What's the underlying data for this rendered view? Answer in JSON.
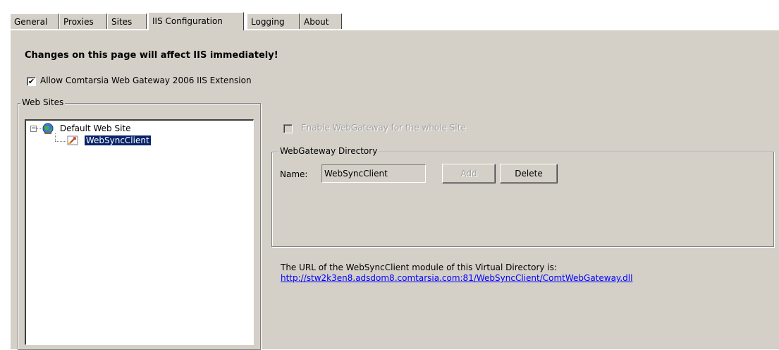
{
  "tabs": [
    {
      "label": "General"
    },
    {
      "label": "Proxies"
    },
    {
      "label": "Sites"
    },
    {
      "label": "IIS Configuration",
      "active": true
    },
    {
      "label": "Logging"
    },
    {
      "label": "About"
    }
  ],
  "page": {
    "warning": "Changes on this page will affect IIS immediately!",
    "allow_extension": {
      "label": "Allow Comtarsia Web Gateway 2006 IIS Extension",
      "checked": true
    }
  },
  "web_sites": {
    "legend": "Web Sites",
    "tree": {
      "root": {
        "label": "Default Web Site",
        "expanded": true,
        "icon": "globe-icon"
      },
      "child": {
        "label": "WebSyncClient",
        "selected": true,
        "icon": "virtual-directory-icon"
      }
    }
  },
  "enable_site": {
    "label": "Enable WebGateway for the whole Site",
    "checked": false,
    "enabled": false
  },
  "directory": {
    "legend": "WebGateway Directory",
    "name_label": "Name:",
    "name_value": "WebSyncClient",
    "add_label": "Add",
    "delete_label": "Delete"
  },
  "url_info": {
    "text": "The URL of the WebSyncClient module of this Virtual Directory is:",
    "url": "http://stw2k3en8.adsdom8.comtarsia.com:81/WebSyncClient/ComtWebGateway.dll"
  },
  "colors": {
    "panel": "#d4d0c8",
    "selection": "#0a246a",
    "link": "#0000ff"
  }
}
